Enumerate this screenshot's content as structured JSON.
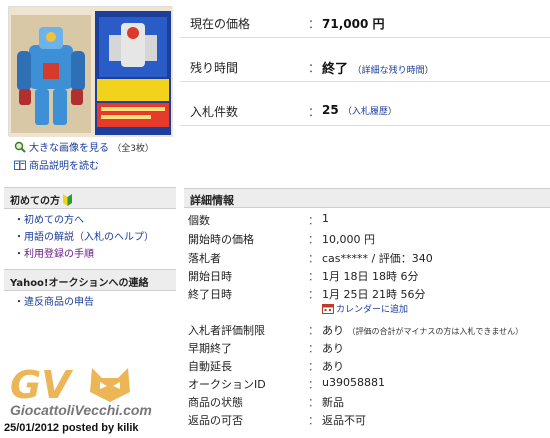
{
  "left": {
    "image_links": {
      "enlarge": "大きな画像を見る",
      "count": "（全3枚）",
      "description": "商品説明を読む"
    },
    "beginner_box": {
      "title": "初めての方",
      "items": [
        {
          "label": "初めての方へ",
          "color": "#1a3c9c"
        },
        {
          "label": "用語の解説（入札のヘルプ）",
          "color": "#1a3c9c"
        },
        {
          "label": "利用登録の手順",
          "color": "#6a1a8a"
        }
      ]
    },
    "contact_box": {
      "title": "Yahoo!オークションへの連絡",
      "items": [
        {
          "label": "違反商品の申告",
          "color": "#1a3c9c"
        }
      ]
    }
  },
  "summary": {
    "price_label": "現在の価格",
    "price_value": "71,000 円",
    "time_label": "残り時間",
    "time_value": "終了",
    "time_link": "詳細な残り時間",
    "bids_label": "入札件数",
    "bids_value": "25",
    "bids_link": "入札履歴"
  },
  "details": {
    "header": "詳細情報",
    "rows": [
      {
        "label": "個数",
        "value": "1"
      },
      {
        "label": "開始時の価格",
        "value": "10,000 円"
      },
      {
        "label": "落札者",
        "value": "cas***** / 評価：340"
      },
      {
        "label": "開始日時",
        "value": "1月 18日 18時 6分"
      },
      {
        "label": "終了日時",
        "value": "1月 25日 21時 56分"
      },
      {
        "label": "入札者評価制限",
        "value": "あり",
        "note": "（評価の合計がマイナスの方は入札できません）"
      },
      {
        "label": "早期終了",
        "value": "あり"
      },
      {
        "label": "自動延長",
        "value": "あり"
      },
      {
        "label": "オークションID",
        "value": "u39058881"
      },
      {
        "label": "商品の状態",
        "value": "新品"
      },
      {
        "label": "返品の可否",
        "value": "返品不可"
      }
    ],
    "calendar_link": "カレンダーに追加",
    "separator": "："
  },
  "watermark": {
    "logo_letters": "GV",
    "site": "GiocattoliVecchi.com",
    "posted": "25/01/2012 posted by kilik"
  },
  "colors": {
    "link": "#1a3c9c",
    "visited": "#6a1a8a",
    "header_bg": "#ededed",
    "watermark": "#e9a93a"
  }
}
